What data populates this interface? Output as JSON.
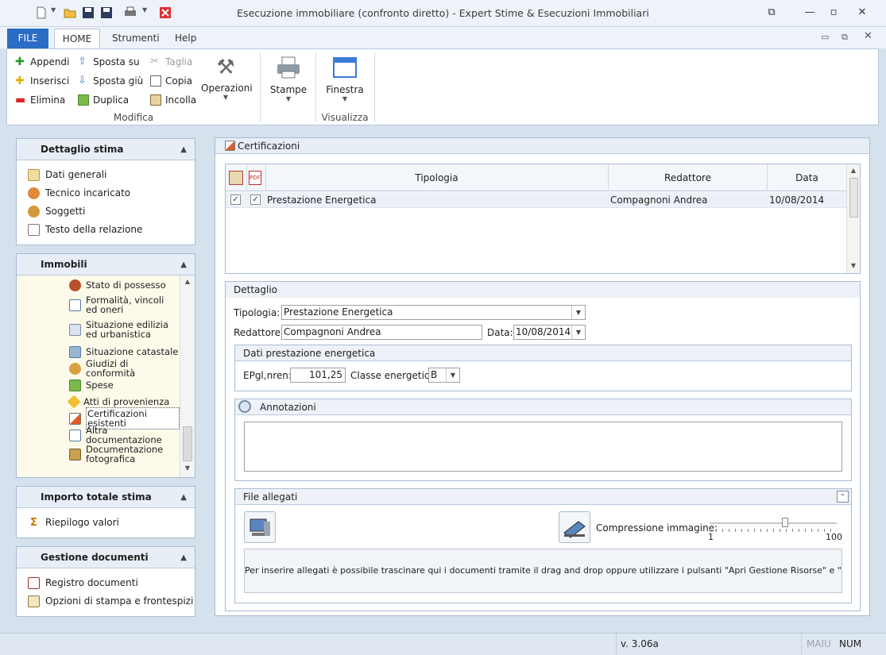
{
  "window": {
    "title": "Esecuzione immobiliare (confronto diretto) - Expert Stime & Esecuzioni Immobiliari"
  },
  "tabs": {
    "file": "FILE",
    "home": "HOME",
    "strumenti": "Strumenti",
    "help": "Help"
  },
  "ribbon": {
    "appendi": "Appendi",
    "inserisci": "Inserisci",
    "elimina": "Elimina",
    "sposta_su": "Sposta su",
    "sposta_giu": "Sposta giù",
    "duplica": "Duplica",
    "taglia": "Taglia",
    "copia": "Copia",
    "incolla": "Incolla",
    "operazioni": "Operazioni",
    "stampe": "Stampe",
    "finestra": "Finestra",
    "group_modifica": "Modifica",
    "group_visualizza": "Visualizza"
  },
  "sidebar": {
    "dettaglio": {
      "title": "Dettaglio stima",
      "items": [
        "Dati generali",
        "Tecnico incaricato",
        "Soggetti",
        "Testo della relazione"
      ]
    },
    "immobili": {
      "title": "Immobili",
      "items": [
        "Stato di possesso",
        "Formalità, vincoli ed oneri",
        "Situazione edilizia ed urbanistica",
        "Situazione catastale",
        "Giudizi di conformità",
        "Spese",
        "Atti di provenienza",
        "Certificazioni esistenti",
        "Altra documentazione",
        "Documentazione fotografica"
      ]
    },
    "importo": {
      "title": "Importo totale stima",
      "items": [
        "Riepilogo valori"
      ]
    },
    "gestione": {
      "title": "Gestione documenti",
      "items": [
        "Registro documenti",
        "Opzioni di stampa e frontespizi"
      ]
    }
  },
  "certificazioni": {
    "title": "Certificazioni",
    "columns": {
      "tipologia": "Tipologia",
      "redattore": "Redattore",
      "data": "Data"
    },
    "rows": [
      {
        "tipologia": "Prestazione Energetica",
        "redattore": "Compagnoni Andrea",
        "data": "10/08/2014",
        "c1": "✓",
        "c2": "✓"
      }
    ]
  },
  "dettaglio": {
    "title": "Dettaglio",
    "tipologia_label": "Tipologia:",
    "tipologia_value": "Prestazione Energetica",
    "redattore_label": "Redattore:",
    "redattore_value": "Compagnoni Andrea",
    "data_label": "Data:",
    "data_value": "10/08/2014",
    "prestazione": {
      "title": "Dati prestazione energetica",
      "epgl_label": "EPgl,nren:",
      "epgl_value": "101,25",
      "classe_label": "Classe energetica:",
      "classe_value": "B"
    },
    "annotazioni": {
      "title": "Annotazioni"
    },
    "file_allegati": {
      "title": "File allegati",
      "compressione_label": "Compressione immagine:",
      "slider_min": "1",
      "slider_max": "100",
      "slider_value_fraction": 0.6,
      "hint": "Per inserire allegati è possibile trascinare qui i documenti tramite il drag and drop oppure utilizzare i pulsanti \"Apri Gestione Risorse\" e \"Scanner\""
    }
  },
  "status": {
    "version": "v. 3.06a",
    "maiu": "MAIU",
    "num": "NUM"
  }
}
